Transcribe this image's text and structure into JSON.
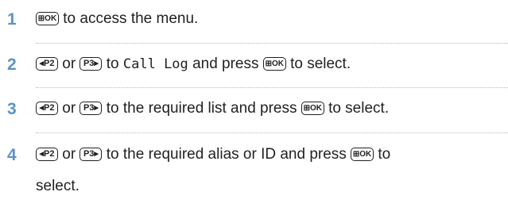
{
  "steps": [
    {
      "number": "1",
      "menu_key": "⊞OK",
      "text": "to access the menu."
    },
    {
      "number": "2",
      "key_left": "◂P2",
      "or": "or",
      "key_right": "P3▸",
      "text_a": "to",
      "mono": "Call Log",
      "text_b": "and press",
      "menu_key": "⊞OK",
      "text_c": "to select."
    },
    {
      "number": "3",
      "key_left": "◂P2",
      "or": "or",
      "key_right": "P3▸",
      "text_a": "to the required list and press",
      "menu_key": "⊞OK",
      "text_c": "to select."
    },
    {
      "number": "4",
      "key_left": "◂P2",
      "or": "or",
      "key_right": "P3▸",
      "text_a": "to the required alias or ID and press",
      "menu_key": "⊞OK",
      "text_c": "to",
      "text_d": "select."
    }
  ]
}
